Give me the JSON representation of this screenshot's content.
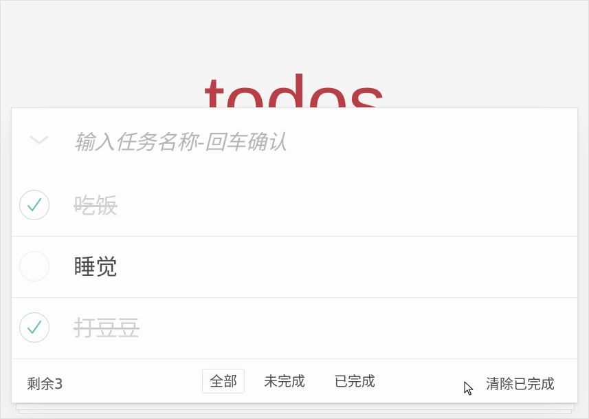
{
  "app": {
    "title": "todos"
  },
  "new_todo": {
    "placeholder": "输入任务名称-回车确认",
    "value": ""
  },
  "todos": [
    {
      "label": "吃饭",
      "completed": true
    },
    {
      "label": "睡觉",
      "completed": false
    },
    {
      "label": "打豆豆",
      "completed": true
    }
  ],
  "footer": {
    "count_label": "剩余3",
    "filters": [
      {
        "label": "全部",
        "selected": true
      },
      {
        "label": "未完成",
        "selected": false
      },
      {
        "label": "已完成",
        "selected": false
      }
    ],
    "clear_label": "清除已完成"
  },
  "colors": {
    "title": "#b83f45",
    "check": "#5dc2af",
    "completed_text": "#d0d0d0",
    "selected_filter_border": "#f0dcdd"
  },
  "icons": {
    "toggle_all": "chevron-down-icon",
    "check": "checkmark-icon",
    "cursor": "mouse-pointer-icon"
  }
}
